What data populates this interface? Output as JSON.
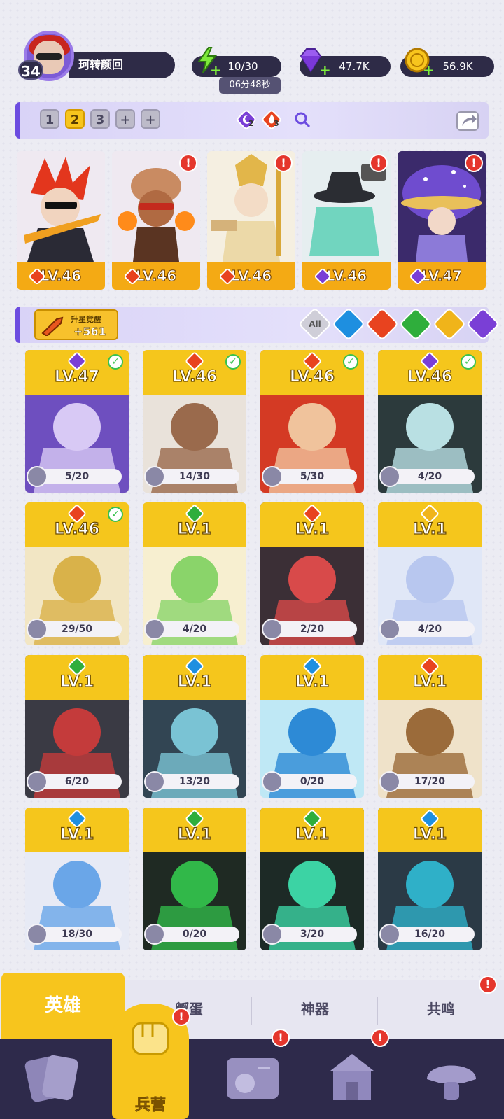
{
  "player": {
    "level": "34",
    "name": "珂转颜回"
  },
  "resources": {
    "energy": "10/30",
    "energy_timer": "06分48秒",
    "gems": "47.7K",
    "coins": "56.9K"
  },
  "team_bar": {
    "slots": [
      "1",
      "2",
      "3",
      "+",
      "+"
    ],
    "active_slot": "2",
    "cost_moon": "2",
    "cost_fire": "3"
  },
  "team_heroes": [
    {
      "level": "LV.46",
      "element": "fire",
      "warn": false
    },
    {
      "level": "LV.46",
      "element": "fire",
      "warn": true
    },
    {
      "level": "LV.46",
      "element": "fire",
      "warn": true
    },
    {
      "level": "LV.46",
      "element": "moon",
      "warn": true
    },
    {
      "level": "LV.47",
      "element": "moon",
      "warn": true
    }
  ],
  "filter": {
    "awaken_label": "升星觉醒",
    "awaken_value": "+561",
    "all_label": "All"
  },
  "heroes": [
    {
      "level": "LV.47",
      "progress": "5/20",
      "element": "moon",
      "checked": true
    },
    {
      "level": "LV.46",
      "progress": "14/30",
      "element": "fire",
      "checked": true
    },
    {
      "level": "LV.46",
      "progress": "5/30",
      "element": "fire",
      "checked": true
    },
    {
      "level": "LV.46",
      "progress": "4/20",
      "element": "moon",
      "checked": true
    },
    {
      "level": "LV.46",
      "progress": "29/50",
      "element": "fire",
      "checked": true
    },
    {
      "level": "LV.1",
      "progress": "4/20",
      "element": "nature",
      "checked": false
    },
    {
      "level": "LV.1",
      "progress": "2/20",
      "element": "fire",
      "checked": false
    },
    {
      "level": "LV.1",
      "progress": "4/20",
      "element": "light",
      "checked": false
    },
    {
      "level": "LV.1",
      "progress": "6/20",
      "element": "nature",
      "checked": false
    },
    {
      "level": "LV.1",
      "progress": "13/20",
      "element": "water",
      "checked": false
    },
    {
      "level": "LV.1",
      "progress": "0/20",
      "element": "water",
      "checked": false
    },
    {
      "level": "LV.1",
      "progress": "17/20",
      "element": "fire",
      "checked": false
    },
    {
      "level": "LV.1",
      "progress": "18/30",
      "element": "water",
      "checked": false
    },
    {
      "level": "LV.1",
      "progress": "0/20",
      "element": "nature",
      "checked": false
    },
    {
      "level": "LV.1",
      "progress": "3/20",
      "element": "nature",
      "checked": false
    },
    {
      "level": "LV.1",
      "progress": "16/20",
      "element": "water",
      "checked": false
    }
  ],
  "tabs": {
    "heroes": "英雄",
    "hatch": "孵蛋",
    "artifact": "神器",
    "resonance": "共鸣"
  },
  "nav": {
    "barracks": "兵营"
  },
  "colors": {
    "fire": "#e8431f",
    "moon": "#7a3fd6",
    "water": "#1e8fe0",
    "nature": "#2fae3c",
    "light": "#f0b41a",
    "accent": "#f7c51d"
  }
}
